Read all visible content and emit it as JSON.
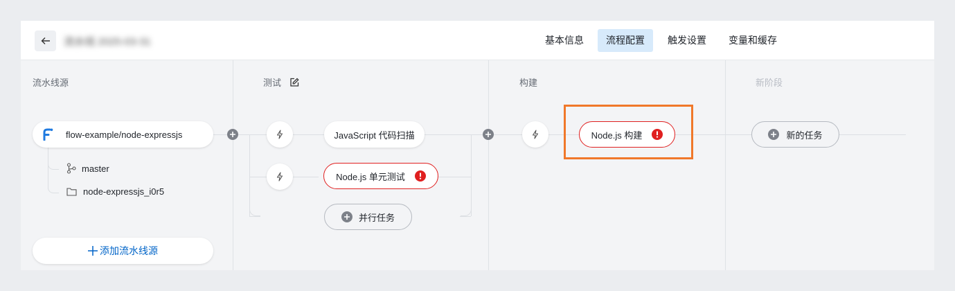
{
  "header": {
    "back_icon": "arrow-left-icon",
    "pipeline_title": "流水线 2025-03-31",
    "tabs": [
      {
        "label": "基本信息",
        "active": false
      },
      {
        "label": "流程配置",
        "active": true
      },
      {
        "label": "触发设置",
        "active": false
      },
      {
        "label": "变量和缓存",
        "active": false
      }
    ]
  },
  "stages": {
    "source": {
      "title": "流水线源",
      "repo": {
        "icon": "flow-logo-icon",
        "name": "flow-example/node-expressjs"
      },
      "branch": {
        "icon": "branch-icon",
        "name": "master"
      },
      "directory": {
        "icon": "folder-icon",
        "name": "node-expressjs_i0r5"
      },
      "add_button": "添加流水线源"
    },
    "test": {
      "title": "测试",
      "edit_icon": "edit-icon",
      "jobs": [
        {
          "label": "JavaScript 代码扫描",
          "error": false
        },
        {
          "label": "Node.js 单元测试",
          "error": true
        }
      ],
      "parallel_button": "并行任务"
    },
    "build": {
      "title": "构建",
      "jobs": [
        {
          "label": "Node.js 构建",
          "error": true
        }
      ]
    },
    "new_stage": {
      "title": "新阶段",
      "new_task_button": "新的任务"
    }
  },
  "colors": {
    "accent": "#0064c8",
    "error": "#e02020",
    "highlight": "#f0782a",
    "active_tab": "#d7eafb"
  }
}
